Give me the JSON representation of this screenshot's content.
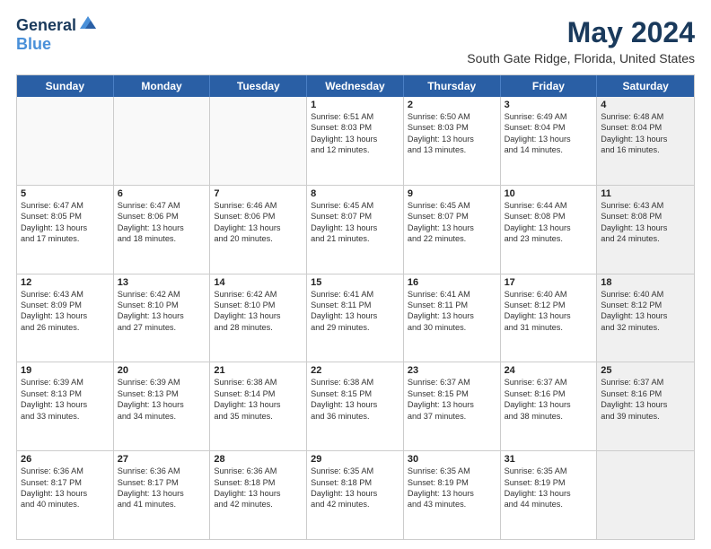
{
  "logo": {
    "line1": "General",
    "line2": "Blue"
  },
  "title": "May 2024",
  "subtitle": "South Gate Ridge, Florida, United States",
  "days_of_week": [
    "Sunday",
    "Monday",
    "Tuesday",
    "Wednesday",
    "Thursday",
    "Friday",
    "Saturday"
  ],
  "weeks": [
    [
      {
        "day": "",
        "lines": [],
        "empty": true
      },
      {
        "day": "",
        "lines": [],
        "empty": true
      },
      {
        "day": "",
        "lines": [],
        "empty": true
      },
      {
        "day": "1",
        "lines": [
          "Sunrise: 6:51 AM",
          "Sunset: 8:03 PM",
          "Daylight: 13 hours",
          "and 12 minutes."
        ],
        "empty": false
      },
      {
        "day": "2",
        "lines": [
          "Sunrise: 6:50 AM",
          "Sunset: 8:03 PM",
          "Daylight: 13 hours",
          "and 13 minutes."
        ],
        "empty": false
      },
      {
        "day": "3",
        "lines": [
          "Sunrise: 6:49 AM",
          "Sunset: 8:04 PM",
          "Daylight: 13 hours",
          "and 14 minutes."
        ],
        "empty": false
      },
      {
        "day": "4",
        "lines": [
          "Sunrise: 6:48 AM",
          "Sunset: 8:04 PM",
          "Daylight: 13 hours",
          "and 16 minutes."
        ],
        "empty": false,
        "shaded": true
      }
    ],
    [
      {
        "day": "5",
        "lines": [
          "Sunrise: 6:47 AM",
          "Sunset: 8:05 PM",
          "Daylight: 13 hours",
          "and 17 minutes."
        ],
        "empty": false
      },
      {
        "day": "6",
        "lines": [
          "Sunrise: 6:47 AM",
          "Sunset: 8:06 PM",
          "Daylight: 13 hours",
          "and 18 minutes."
        ],
        "empty": false
      },
      {
        "day": "7",
        "lines": [
          "Sunrise: 6:46 AM",
          "Sunset: 8:06 PM",
          "Daylight: 13 hours",
          "and 20 minutes."
        ],
        "empty": false
      },
      {
        "day": "8",
        "lines": [
          "Sunrise: 6:45 AM",
          "Sunset: 8:07 PM",
          "Daylight: 13 hours",
          "and 21 minutes."
        ],
        "empty": false
      },
      {
        "day": "9",
        "lines": [
          "Sunrise: 6:45 AM",
          "Sunset: 8:07 PM",
          "Daylight: 13 hours",
          "and 22 minutes."
        ],
        "empty": false
      },
      {
        "day": "10",
        "lines": [
          "Sunrise: 6:44 AM",
          "Sunset: 8:08 PM",
          "Daylight: 13 hours",
          "and 23 minutes."
        ],
        "empty": false
      },
      {
        "day": "11",
        "lines": [
          "Sunrise: 6:43 AM",
          "Sunset: 8:08 PM",
          "Daylight: 13 hours",
          "and 24 minutes."
        ],
        "empty": false,
        "shaded": true
      }
    ],
    [
      {
        "day": "12",
        "lines": [
          "Sunrise: 6:43 AM",
          "Sunset: 8:09 PM",
          "Daylight: 13 hours",
          "and 26 minutes."
        ],
        "empty": false
      },
      {
        "day": "13",
        "lines": [
          "Sunrise: 6:42 AM",
          "Sunset: 8:10 PM",
          "Daylight: 13 hours",
          "and 27 minutes."
        ],
        "empty": false
      },
      {
        "day": "14",
        "lines": [
          "Sunrise: 6:42 AM",
          "Sunset: 8:10 PM",
          "Daylight: 13 hours",
          "and 28 minutes."
        ],
        "empty": false
      },
      {
        "day": "15",
        "lines": [
          "Sunrise: 6:41 AM",
          "Sunset: 8:11 PM",
          "Daylight: 13 hours",
          "and 29 minutes."
        ],
        "empty": false
      },
      {
        "day": "16",
        "lines": [
          "Sunrise: 6:41 AM",
          "Sunset: 8:11 PM",
          "Daylight: 13 hours",
          "and 30 minutes."
        ],
        "empty": false
      },
      {
        "day": "17",
        "lines": [
          "Sunrise: 6:40 AM",
          "Sunset: 8:12 PM",
          "Daylight: 13 hours",
          "and 31 minutes."
        ],
        "empty": false
      },
      {
        "day": "18",
        "lines": [
          "Sunrise: 6:40 AM",
          "Sunset: 8:12 PM",
          "Daylight: 13 hours",
          "and 32 minutes."
        ],
        "empty": false,
        "shaded": true
      }
    ],
    [
      {
        "day": "19",
        "lines": [
          "Sunrise: 6:39 AM",
          "Sunset: 8:13 PM",
          "Daylight: 13 hours",
          "and 33 minutes."
        ],
        "empty": false
      },
      {
        "day": "20",
        "lines": [
          "Sunrise: 6:39 AM",
          "Sunset: 8:13 PM",
          "Daylight: 13 hours",
          "and 34 minutes."
        ],
        "empty": false
      },
      {
        "day": "21",
        "lines": [
          "Sunrise: 6:38 AM",
          "Sunset: 8:14 PM",
          "Daylight: 13 hours",
          "and 35 minutes."
        ],
        "empty": false
      },
      {
        "day": "22",
        "lines": [
          "Sunrise: 6:38 AM",
          "Sunset: 8:15 PM",
          "Daylight: 13 hours",
          "and 36 minutes."
        ],
        "empty": false
      },
      {
        "day": "23",
        "lines": [
          "Sunrise: 6:37 AM",
          "Sunset: 8:15 PM",
          "Daylight: 13 hours",
          "and 37 minutes."
        ],
        "empty": false
      },
      {
        "day": "24",
        "lines": [
          "Sunrise: 6:37 AM",
          "Sunset: 8:16 PM",
          "Daylight: 13 hours",
          "and 38 minutes."
        ],
        "empty": false
      },
      {
        "day": "25",
        "lines": [
          "Sunrise: 6:37 AM",
          "Sunset: 8:16 PM",
          "Daylight: 13 hours",
          "and 39 minutes."
        ],
        "empty": false,
        "shaded": true
      }
    ],
    [
      {
        "day": "26",
        "lines": [
          "Sunrise: 6:36 AM",
          "Sunset: 8:17 PM",
          "Daylight: 13 hours",
          "and 40 minutes."
        ],
        "empty": false
      },
      {
        "day": "27",
        "lines": [
          "Sunrise: 6:36 AM",
          "Sunset: 8:17 PM",
          "Daylight: 13 hours",
          "and 41 minutes."
        ],
        "empty": false
      },
      {
        "day": "28",
        "lines": [
          "Sunrise: 6:36 AM",
          "Sunset: 8:18 PM",
          "Daylight: 13 hours",
          "and 42 minutes."
        ],
        "empty": false
      },
      {
        "day": "29",
        "lines": [
          "Sunrise: 6:35 AM",
          "Sunset: 8:18 PM",
          "Daylight: 13 hours",
          "and 42 minutes."
        ],
        "empty": false
      },
      {
        "day": "30",
        "lines": [
          "Sunrise: 6:35 AM",
          "Sunset: 8:19 PM",
          "Daylight: 13 hours",
          "and 43 minutes."
        ],
        "empty": false
      },
      {
        "day": "31",
        "lines": [
          "Sunrise: 6:35 AM",
          "Sunset: 8:19 PM",
          "Daylight: 13 hours",
          "and 44 minutes."
        ],
        "empty": false
      },
      {
        "day": "",
        "lines": [],
        "empty": true,
        "shaded": true
      }
    ]
  ]
}
